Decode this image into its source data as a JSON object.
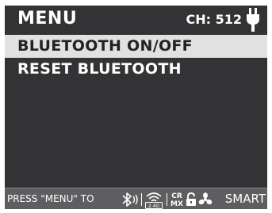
{
  "header": {
    "title": "MENU",
    "channel_label": "CH:",
    "channel_value": "512",
    "power_icon": "plug-icon"
  },
  "menu": {
    "items": [
      {
        "label": "BLUETOOTH ON/OFF",
        "selected": true
      },
      {
        "label": "RESET BLUETOOTH",
        "selected": false
      }
    ]
  },
  "footer": {
    "hint": "PRESS \"MENU\" TO",
    "badge_rf": "2.4G",
    "badge_crmx": [
      "CR",
      "MX"
    ],
    "mode": "SMART",
    "icons": [
      "bluetooth-icon",
      "wireless-2.4g-icon",
      "crmx-icon",
      "lock-icon",
      "fan-icon"
    ]
  },
  "colors": {
    "screen_bg": "#333335",
    "selected_bg": "#e1e1e1",
    "footer_bg": "#5e5e61",
    "text": "#ffffff"
  }
}
